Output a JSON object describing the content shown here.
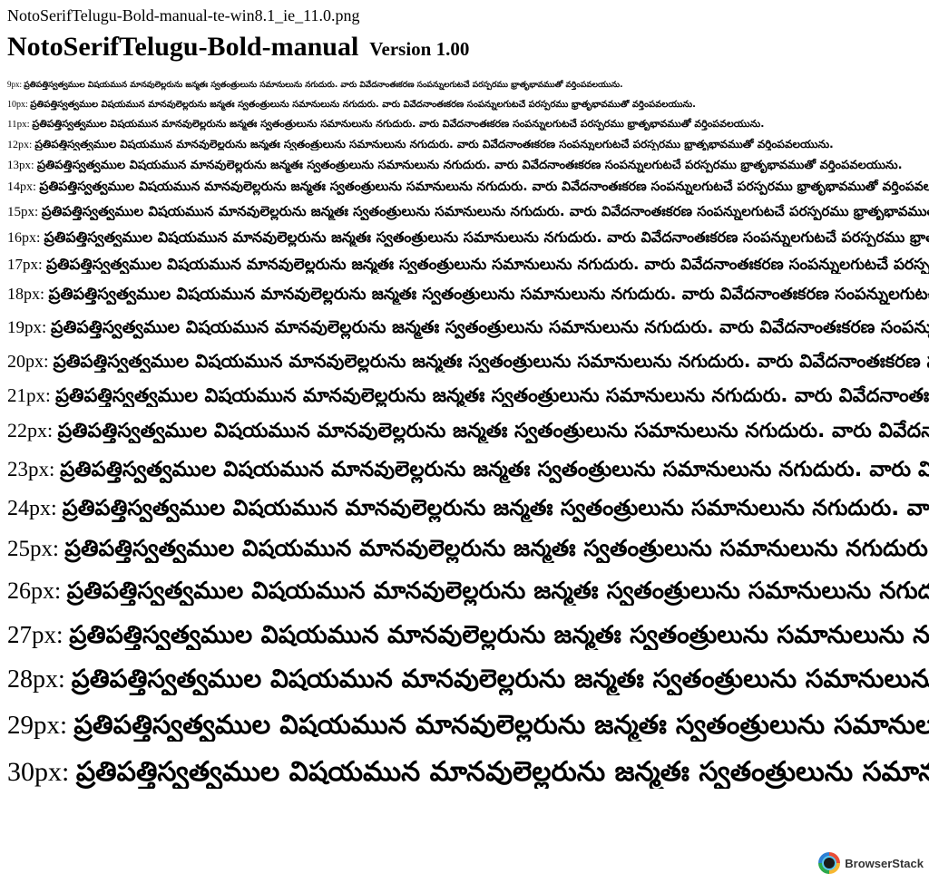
{
  "filename": "NotoSerifTelugu-Bold-manual-te-win8.1_ie_11.0.png",
  "heading": {
    "font_name": "NotoSerifTelugu-Bold-manual",
    "version": "Version 1.00"
  },
  "sample_text": "ప్రతిపత్తిస్వత్వముల విషయమున మానవులెల్లరును జన్మతః స్వతంత్రులును సమానులును నగుదురు. వారు వివేదనాంతఃకరణ సంపన్నులగుటచే పరస్పరము భ్రాతృభావముతో వర్తింపవలయును.",
  "rows": [
    {
      "label": "9px:"
    },
    {
      "label": "10px:"
    },
    {
      "label": "11px:"
    },
    {
      "label": "12px:"
    },
    {
      "label": "13px:"
    },
    {
      "label": "14px:"
    },
    {
      "label": "15px:"
    },
    {
      "label": "16px:"
    },
    {
      "label": "17px:"
    },
    {
      "label": "18px:"
    },
    {
      "label": "19px:"
    },
    {
      "label": "20px:"
    },
    {
      "label": "21px:"
    },
    {
      "label": "22px:"
    },
    {
      "label": "23px:"
    },
    {
      "label": "24px:"
    },
    {
      "label": "25px:"
    },
    {
      "label": "26px:"
    },
    {
      "label": "27px:"
    },
    {
      "label": "28px:"
    },
    {
      "label": "29px:"
    },
    {
      "label": "30px:"
    }
  ],
  "watermark": {
    "brand": "BrowserStack",
    "icon": "browserstack-logo-icon"
  }
}
